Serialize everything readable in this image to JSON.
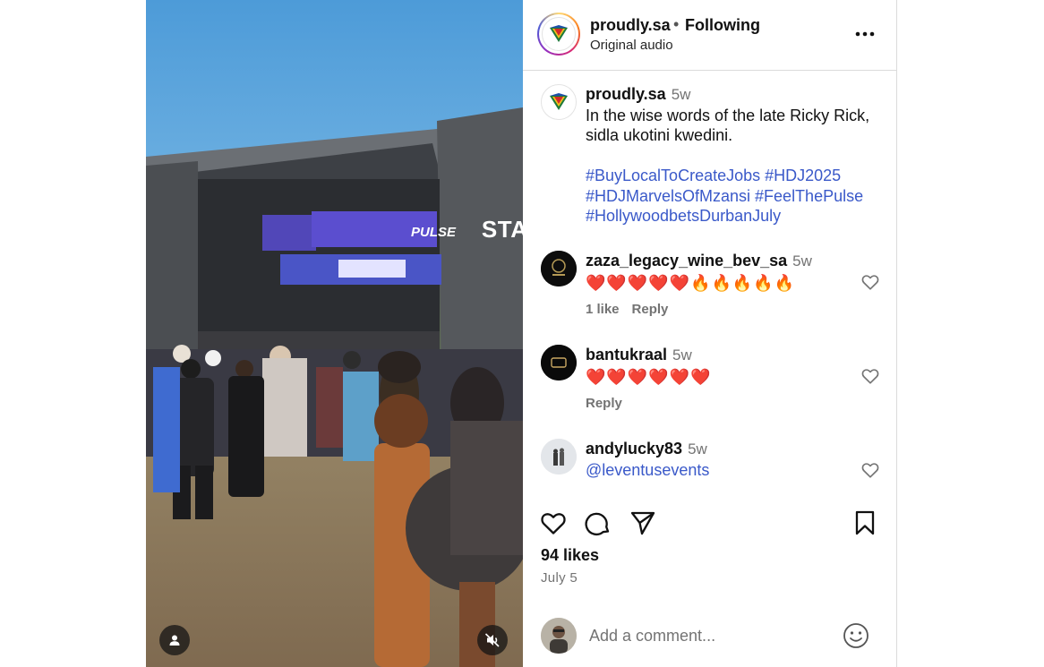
{
  "post": {
    "username": "proudly.sa",
    "follow_status": "Following",
    "audio": "Original audio",
    "time_ago": "5w",
    "caption_line1": "In the wise words of the late Ricky Rick,",
    "caption_line2": "sidla ukotini kwedini.",
    "hashtags_line1": "#BuyLocalToCreateJobs #HDJ2025",
    "hashtags_line2": "#HDJMarvelsOfMzansi #FeelThePulse",
    "hashtags_line3": "#HollywoodbetsDurbanJuly",
    "likes": "94 likes",
    "date": "July 5"
  },
  "media": {
    "stage_sign": "STAGE",
    "pulse_sign": "PULSE"
  },
  "comments": [
    {
      "username": "zaza_legacy_wine_bev_sa",
      "time_ago": "5w",
      "text": "❤️❤️❤️❤️❤️🔥🔥🔥🔥🔥",
      "likes_label": "1 like",
      "reply_label": "Reply"
    },
    {
      "username": "bantukraal",
      "time_ago": "5w",
      "text": "❤️❤️❤️❤️❤️❤️",
      "reply_label": "Reply"
    },
    {
      "username": "andylucky83",
      "time_ago": "5w",
      "text": "@leventusevents"
    }
  ],
  "composer": {
    "placeholder": "Add a comment..."
  },
  "icons": {
    "more": "more-horizontal-icon",
    "like": "heart-icon",
    "comment": "comment-icon",
    "share": "send-icon",
    "save": "bookmark-icon",
    "emoji": "smiley-icon",
    "mute": "muted-speaker-icon",
    "user": "user-icon"
  }
}
